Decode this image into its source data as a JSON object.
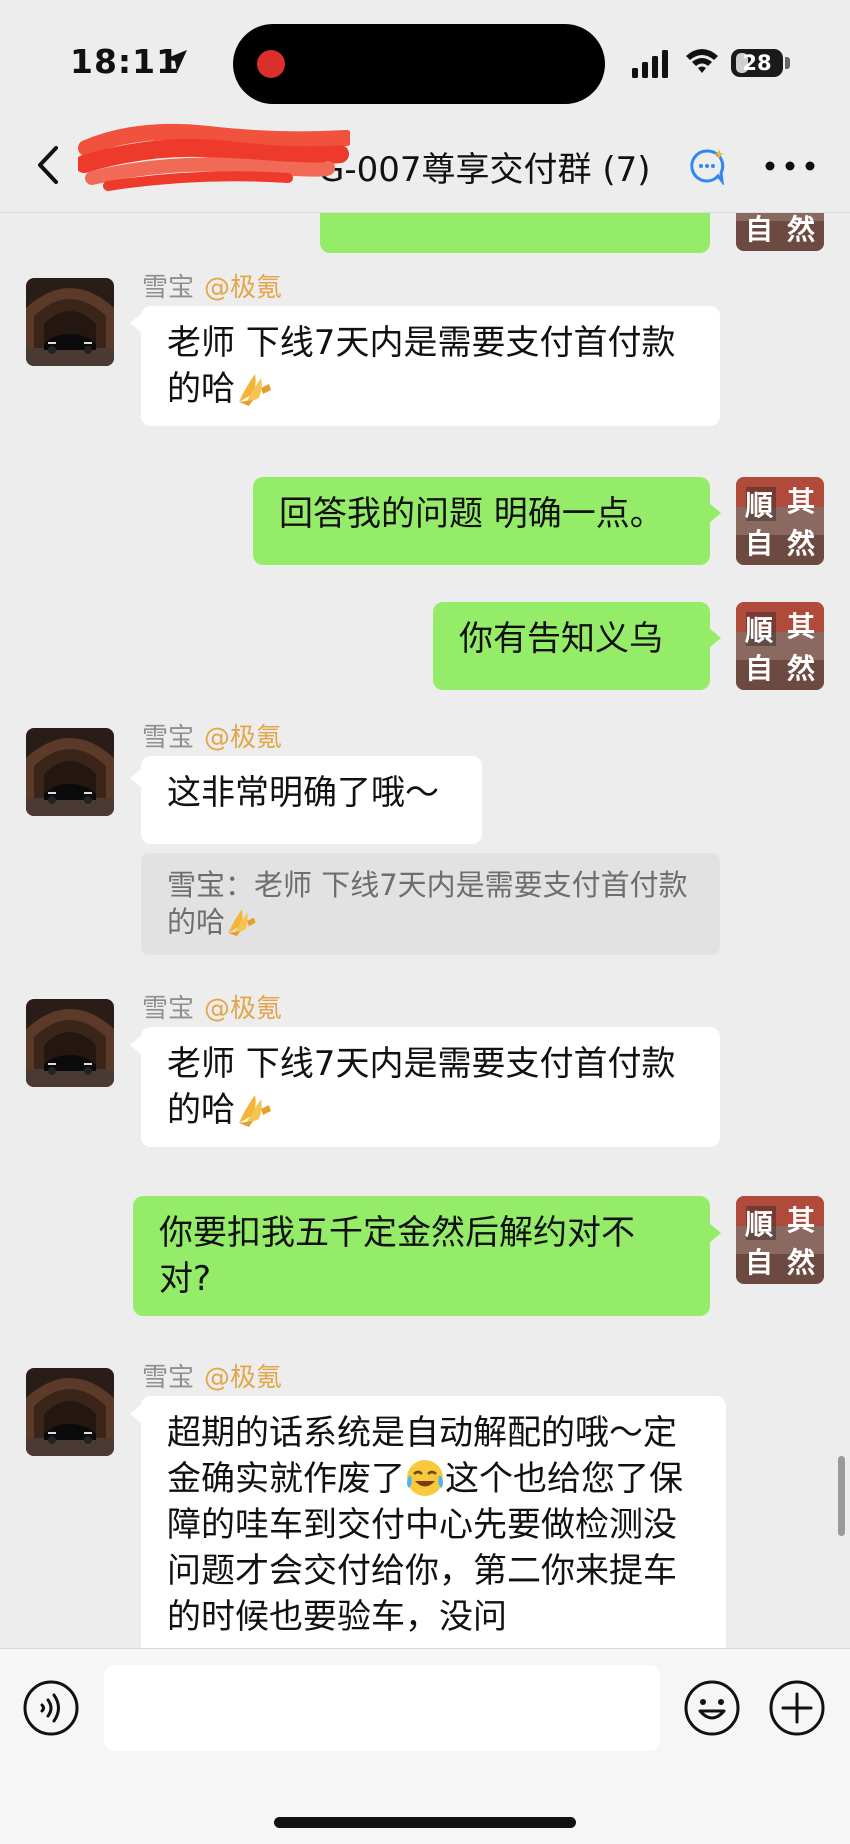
{
  "status_bar": {
    "time": "18:11",
    "battery": "28",
    "battery_fraction": 0.28
  },
  "header": {
    "title": "G-007尊享交付群 (7)",
    "back_icon": "chevron-left-icon",
    "ai_icon": "ai-chat-icon",
    "more_icon": "more-dots-icon"
  },
  "messages": [
    {
      "side": "left",
      "sender": "雪宝",
      "tag": "@极氪",
      "text": "老师 下线7天内是需要支付首付款的哈",
      "emoji": "pray-hands"
    },
    {
      "side": "right",
      "text": "回答我的问题 明确一点。"
    },
    {
      "side": "right",
      "text": "你有告知义乌"
    },
    {
      "side": "left",
      "sender": "雪宝",
      "tag": "@极氪",
      "text": "这非常明确了哦～",
      "quote": "雪宝：老师 下线7天内是需要支付首付款的哈"
    },
    {
      "side": "left",
      "sender": "雪宝",
      "tag": "@极氪",
      "text": "老师 下线7天内是需要支付首付款的哈",
      "emoji": "pray-hands"
    },
    {
      "side": "right",
      "text": "你要扣我五千定金然后解约对不对?"
    },
    {
      "side": "left",
      "sender": "雪宝",
      "tag": "@极氪",
      "text_parts": [
        "超期的话系统是自动解配的哦～定金确实就作废了",
        "这个也给您了保障的哇车到交付中心先要做检测没问题才会交付给你，第二你来提车的时候也要验车，没问"
      ]
    }
  ],
  "avatar_self_text": "順其自然",
  "colors": {
    "bubble_green": "#95ec69",
    "bubble_white": "#ffffff",
    "background": "#ededed",
    "tag_orange": "#e3a64a"
  },
  "input_bar": {
    "voice_icon": "voice-icon",
    "emoji_icon": "emoji-icon",
    "plus_icon": "plus-icon"
  }
}
